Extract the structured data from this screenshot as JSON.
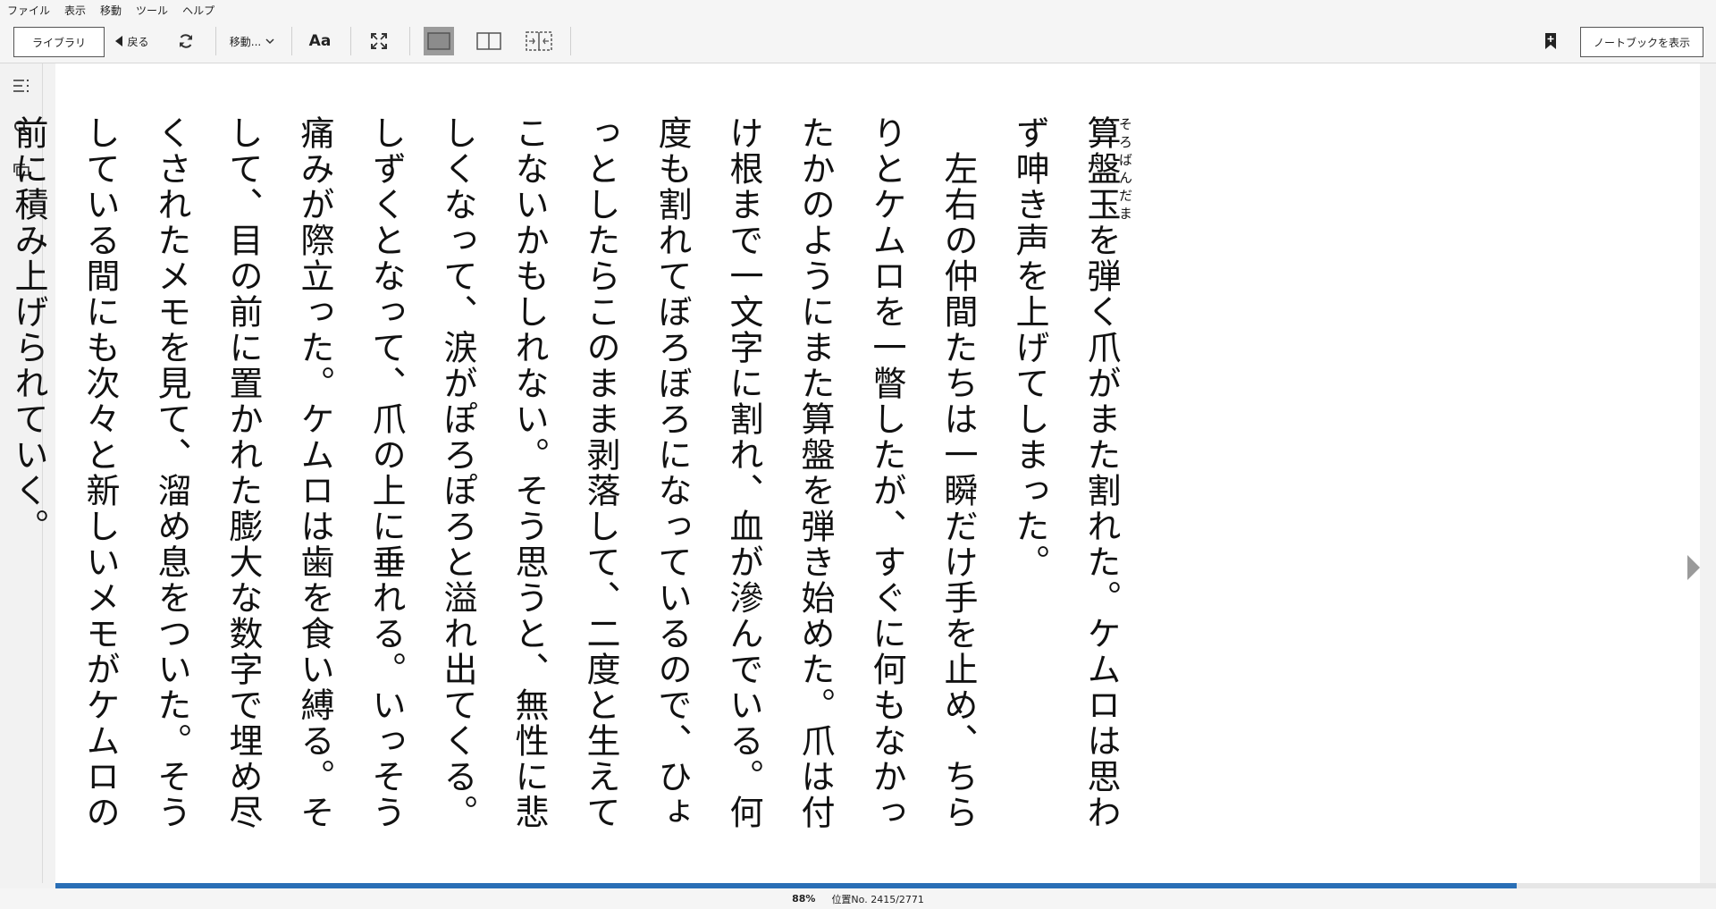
{
  "menu": [
    "ファイル",
    "表示",
    "移動",
    "ツール",
    "ヘルプ"
  ],
  "toolbar": {
    "library_label": "ライブラリ",
    "back_label": "戻る",
    "goto_label": "移動...",
    "font_label": "Aa",
    "notebook_label": "ノートブックを表示"
  },
  "reader": {
    "first_ruby_base": "算盤玉",
    "first_ruby_text": "そろばんだま",
    "first_rest": "を弾く爪がまた割れた。ケムロは思わず呻き声を上げてしまった。",
    "second": "左右の仲間たちは一瞬だけ手を止め、ちらりとケムロを一瞥したが、すぐに何もなかったかのようにまた算盤を弾き始めた。爪は付け根まで一文字に割れ、血が滲んでいる。何度も割れてぼろぼろになっているので、ひょっとしたらこのまま剥落して、二度と生えてこないかもしれない。そう思うと、無性に悲しくなって、涙がぽろぽろと溢れ出てくる。しずくとなって、爪の上に垂れる。いっそう痛みが際立った。ケムロは歯を食い縛る。そして、目の前に置かれた膨大な数字で埋め尽くされたメモを見て、溜め息をついた。そうしている間にも次々と新しいメモがケムロの前に積み上げられていく。"
  },
  "status": {
    "percent": "88%",
    "location": "位置No. 2415/2771",
    "progress_fraction": 0.88
  },
  "colors": {
    "progress": "#2a6fb6",
    "active_view": "#9b9b9b"
  }
}
